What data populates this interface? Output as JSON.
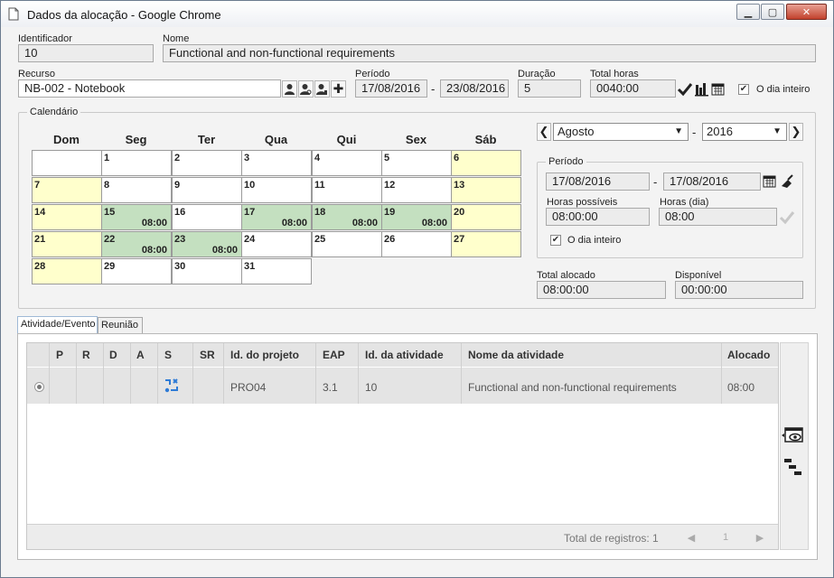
{
  "window": {
    "title": "Dados da alocação - Google Chrome",
    "min_glyph": "▁",
    "max_glyph": "▢",
    "close_glyph": "✕"
  },
  "header": {
    "id_label": "Identificador",
    "id_value": "10",
    "name_label": "Nome",
    "name_value": "Functional and non-functional requirements"
  },
  "resource": {
    "label": "Recurso",
    "value": "NB-002 - Notebook",
    "period_label": "Período",
    "period_start": "17/08/2016",
    "period_sep": "-",
    "period_end": "23/08/2016",
    "duration_label": "Duração",
    "duration_value": "5",
    "total_label": "Total horas",
    "total_value": "0040:00",
    "full_day_label": "O dia inteiro",
    "full_day_checked": true
  },
  "calendar": {
    "legend": "Calendário",
    "weekdays": [
      "Dom",
      "Seg",
      "Ter",
      "Qua",
      "Qui",
      "Sex",
      "Sáb"
    ],
    "weeks": [
      [
        {
          "day": ""
        },
        {
          "day": "1"
        },
        {
          "day": "2"
        },
        {
          "day": "3"
        },
        {
          "day": "4"
        },
        {
          "day": "5"
        },
        {
          "day": "6",
          "type": "weekend"
        }
      ],
      [
        {
          "day": "7",
          "type": "weekend"
        },
        {
          "day": "8"
        },
        {
          "day": "9"
        },
        {
          "day": "10"
        },
        {
          "day": "11"
        },
        {
          "day": "12"
        },
        {
          "day": "13",
          "type": "weekend"
        }
      ],
      [
        {
          "day": "14",
          "type": "weekend"
        },
        {
          "day": "15",
          "type": "alloc",
          "hours": "08:00"
        },
        {
          "day": "16"
        },
        {
          "day": "17",
          "type": "alloc",
          "hours": "08:00"
        },
        {
          "day": "18",
          "type": "alloc",
          "hours": "08:00"
        },
        {
          "day": "19",
          "type": "alloc",
          "hours": "08:00"
        },
        {
          "day": "20",
          "type": "weekend"
        }
      ],
      [
        {
          "day": "21",
          "type": "weekend"
        },
        {
          "day": "22",
          "type": "alloc",
          "hours": "08:00"
        },
        {
          "day": "23",
          "type": "alloc",
          "hours": "08:00"
        },
        {
          "day": "24"
        },
        {
          "day": "25"
        },
        {
          "day": "26"
        },
        {
          "day": "27",
          "type": "weekend"
        }
      ],
      [
        {
          "day": "28",
          "type": "weekend"
        },
        {
          "day": "29"
        },
        {
          "day": "30"
        },
        {
          "day": "31"
        },
        null,
        null,
        null
      ]
    ],
    "month": "Agosto",
    "year_sep": "-",
    "year": "2016",
    "prev_glyph": "❮",
    "next_glyph": "❯"
  },
  "period_panel": {
    "legend": "Período",
    "start": "17/08/2016",
    "sep": "-",
    "end": "17/08/2016",
    "possible_label": "Horas possíveis",
    "possible_value": "08:00:00",
    "day_label": "Horas (dia)",
    "day_value": "08:00",
    "full_day_label": "O dia inteiro",
    "full_day_checked": true
  },
  "totals": {
    "allocated_label": "Total alocado",
    "allocated_value": "08:00:00",
    "available_label": "Disponível",
    "available_value": "00:00:00"
  },
  "tabs": [
    {
      "label": "Atividade/Evento",
      "active": true
    },
    {
      "label": "Reunião",
      "active": false
    }
  ],
  "grid": {
    "columns": [
      "P",
      "R",
      "D",
      "A",
      "S",
      "SR",
      "Id. do projeto",
      "EAP",
      "Id. da atividade",
      "Nome da atividade",
      "Alocado"
    ],
    "rows": [
      {
        "project_id": "PRO04",
        "wbs": "3.1",
        "activity_id": "10",
        "activity_name": "Functional and non-functional requirements",
        "allocated": "08:00"
      }
    ],
    "footer_total": "Total de registros: 1",
    "page": "1",
    "prev_glyph": "◀",
    "next_glyph": "▶"
  },
  "colors": {
    "weekend": "#ffffcc",
    "allocated": "#c4e0c0",
    "accent": "#2e7bd6"
  }
}
